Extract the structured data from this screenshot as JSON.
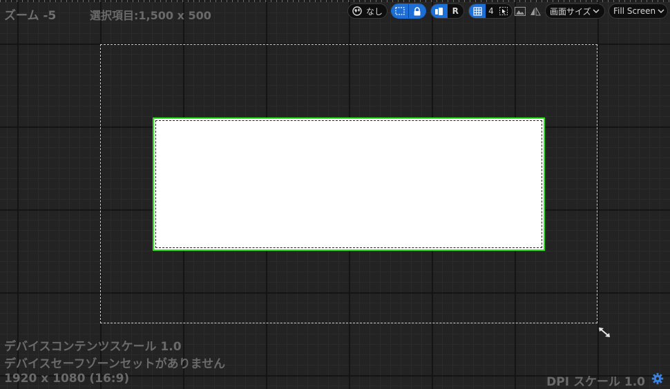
{
  "zoom": {
    "label": "ズーム -5"
  },
  "selection": {
    "label": "選択項目:1,500 x 500"
  },
  "toolbar": {
    "locale_value": "なし",
    "r_label": "R",
    "grid_value": "4",
    "screen_size_label": "画面サイズ",
    "fill_label": "Fill Screen"
  },
  "info": {
    "content_scale": "デバイスコンテンツスケール 1.0",
    "safe_zone": "デバイスセーフゾーンセットがありません",
    "resolution": "1920 x 1080 (16:9)",
    "dpi": "DPI スケール 1.0"
  },
  "colors": {
    "selection_outline": "#2ee61c",
    "toggle_active": "#1d6fd6",
    "canvas_background": "#232323"
  }
}
